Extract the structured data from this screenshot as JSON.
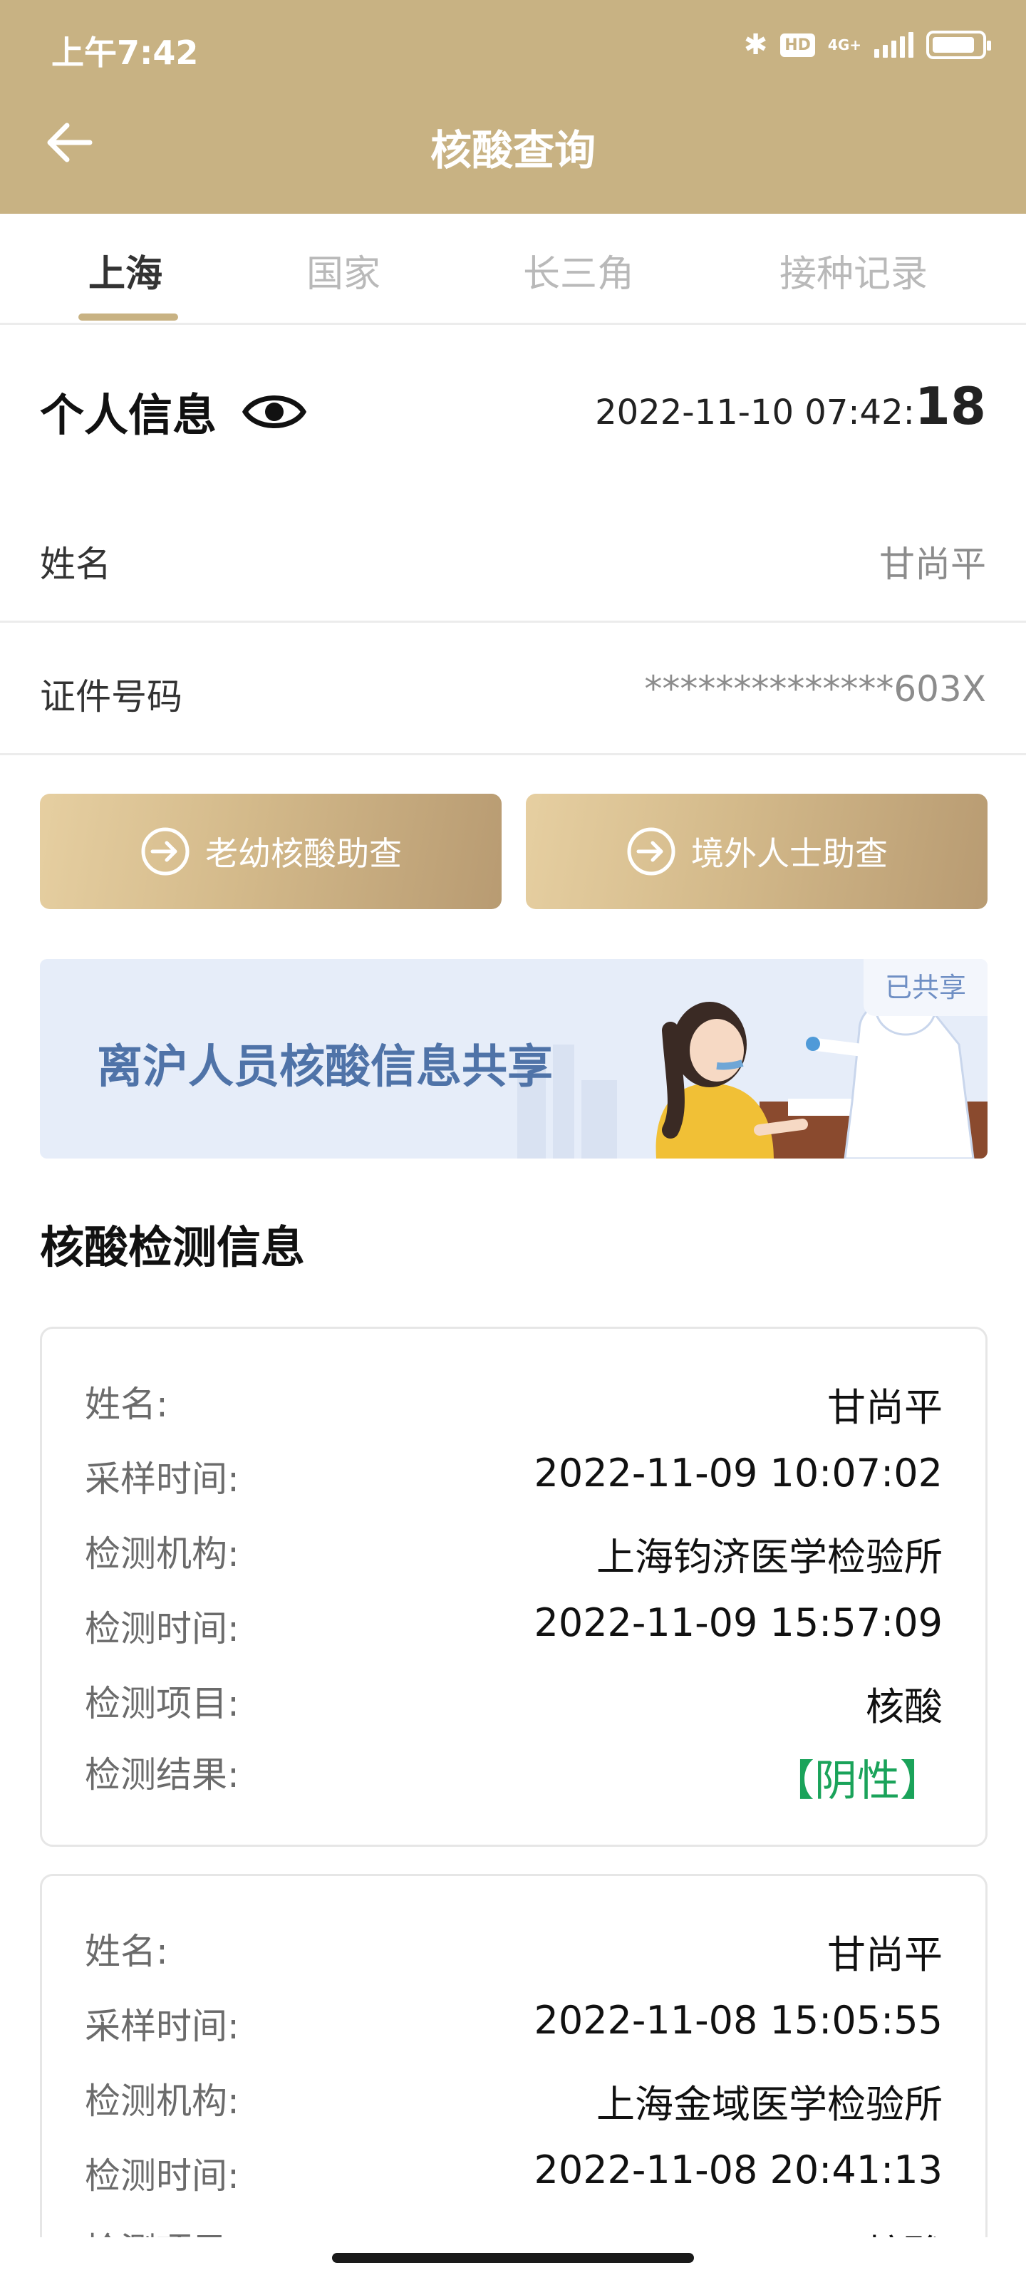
{
  "status_bar": {
    "time": "上午7:42",
    "network": "4G+"
  },
  "header": {
    "title": "核酸查询"
  },
  "tabs": [
    {
      "label": "上海",
      "active": true
    },
    {
      "label": "国家",
      "active": false
    },
    {
      "label": "长三角",
      "active": false
    },
    {
      "label": "接种记录",
      "active": false
    }
  ],
  "personal_info": {
    "title": "个人信息",
    "timestamp_main": "2022-11-10 07:42:",
    "timestamp_seconds": "18",
    "name_label": "姓名",
    "name_value": "甘尚平",
    "id_label": "证件号码",
    "id_value": "**************603X"
  },
  "buttons": {
    "elderly": "老幼核酸助查",
    "overseas": "境外人士助查"
  },
  "banner": {
    "text": "离沪人员核酸信息共享",
    "tag": "已共享"
  },
  "section_title": "核酸检测信息",
  "labels": {
    "name": "姓名:",
    "sample_time": "采样时间:",
    "institution": "检测机构:",
    "test_time": "检测时间:",
    "item": "检测项目:",
    "result": "检测结果:"
  },
  "records": [
    {
      "name": "甘尚平",
      "sample_time": "2022-11-09 10:07:02",
      "institution": "上海钧济医学检验所",
      "test_time": "2022-11-09 15:57:09",
      "item": "核酸",
      "result": "【阴性】"
    },
    {
      "name": "甘尚平",
      "sample_time": "2022-11-08 15:05:55",
      "institution": "上海金域医学检验所",
      "test_time": "2022-11-08 20:41:13",
      "item": "核酸"
    }
  ],
  "colors": {
    "header_bg": "#c8b283",
    "accent_gold": "#c8b283",
    "result_positive_green": "#1aa35a",
    "banner_text_blue": "#4f73a8"
  }
}
